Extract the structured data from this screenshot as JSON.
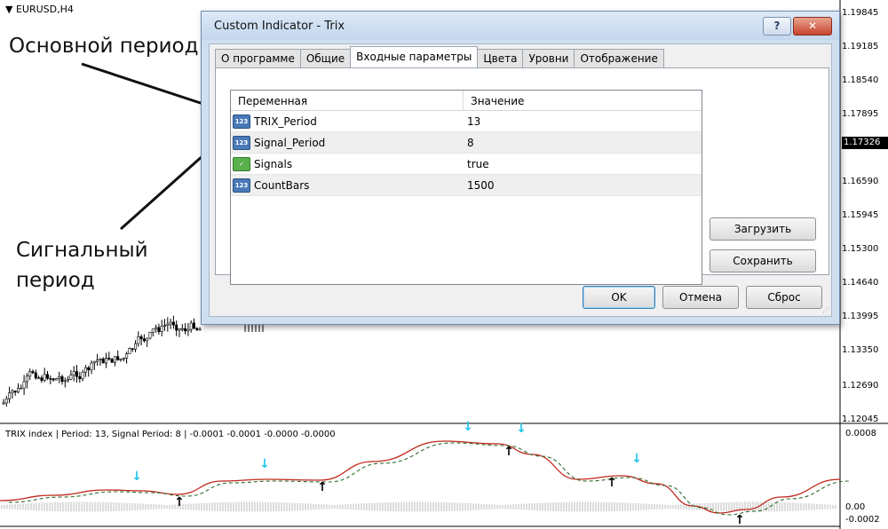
{
  "chart": {
    "symbol": "EURUSD,H4",
    "price_axis": [
      "1.19845",
      "1.19185",
      "1.18540",
      "1.17895",
      "1.17326",
      "1.16590",
      "1.15945",
      "1.15300",
      "1.14640",
      "1.13995",
      "1.13350",
      "1.12690",
      "1.12045"
    ],
    "current_price": "1.17326"
  },
  "indicator": {
    "legend": "TRIX index | Period: 13, Signal Period: 8 |  -0.0001 -0.0001 -0.0000 -0.0000",
    "axis": [
      "0.0008",
      "0.00",
      "-0.0002"
    ]
  },
  "annotations": {
    "main_period": "Основной период",
    "signal_period_line1": "Сигнальный",
    "signal_period_line2": "период"
  },
  "dialog": {
    "title": "Custom Indicator - Trix",
    "help": "?",
    "close": "✕",
    "tabs": [
      "О программе",
      "Общие",
      "Входные параметры",
      "Цвета",
      "Уровни",
      "Отображение"
    ],
    "active_tab": "Входные параметры",
    "columns": {
      "name": "Переменная",
      "value": "Значение"
    },
    "params": [
      {
        "icon": "123",
        "name": "TRIX_Period",
        "value": "13"
      },
      {
        "icon": "bool",
        "name": "Signal_Period",
        "value": "8"
      },
      {
        "icon": "bool",
        "name": "Signals",
        "value": "true"
      },
      {
        "icon": "123",
        "name": "CountBars",
        "value": "1500"
      }
    ],
    "buttons": {
      "load": "Загрузить",
      "save": "Сохранить",
      "ok": "OK",
      "cancel": "Отмена",
      "reset": "Сброс"
    }
  }
}
